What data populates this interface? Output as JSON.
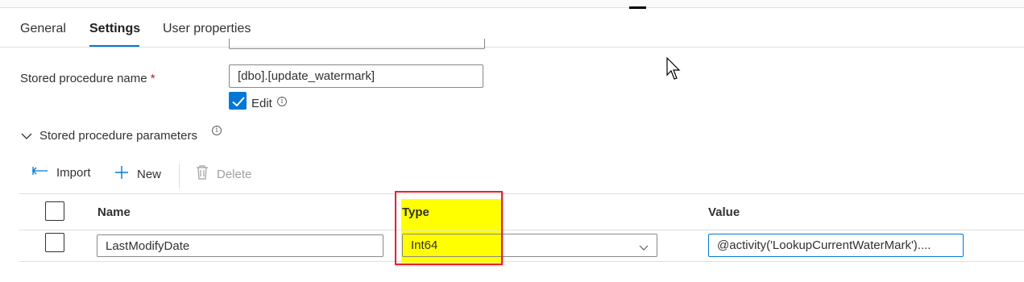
{
  "tabs": [
    {
      "label": "General"
    },
    {
      "label": "Settings"
    },
    {
      "label": "User properties"
    }
  ],
  "stored_procedure": {
    "label": "Stored procedure name",
    "required_mark": "*",
    "value": "[dbo].[update_watermark]",
    "edit_label": "Edit",
    "edit_checked": true
  },
  "parameters_section": {
    "title": "Stored procedure parameters"
  },
  "toolbar": {
    "import_label": "Import",
    "new_label": "New",
    "delete_label": "Delete"
  },
  "table": {
    "columns": [
      "Name",
      "Type",
      "Value"
    ],
    "rows": [
      {
        "name": "LastModifyDate",
        "type": "Int64",
        "value": "@activity('LookupCurrentWaterMark')...."
      }
    ]
  },
  "colors": {
    "accent": "#0078d4",
    "highlight_fill": "#ffff00",
    "highlight_border": "#e0242c"
  }
}
